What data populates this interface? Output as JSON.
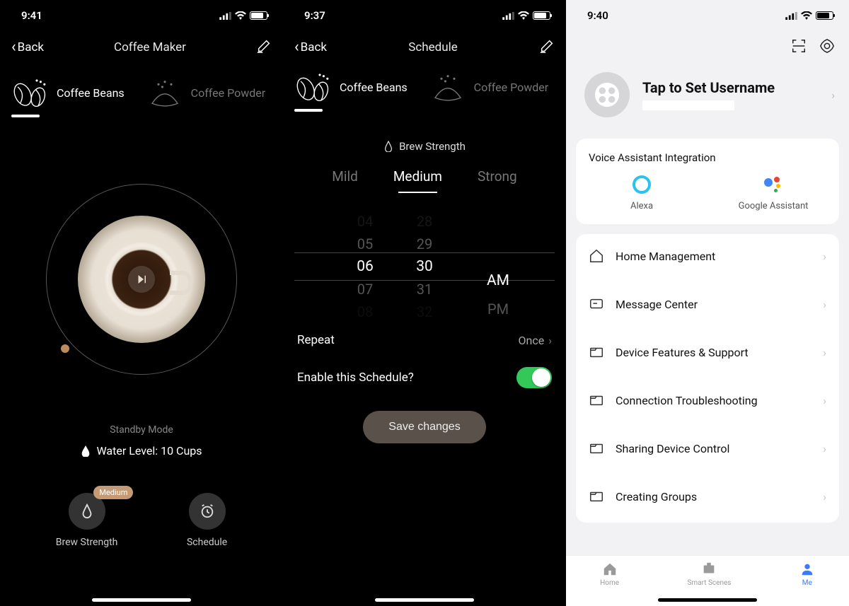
{
  "phone1": {
    "time": "9:41",
    "back": "Back",
    "title": "Coffee Maker",
    "tabs": {
      "beans": "Coffee Beans",
      "powder": "Coffee Powder"
    },
    "standby": "Standby Mode",
    "water_label": "Water Level:  10 Cups",
    "brew_badge": "Medium",
    "brew_label": "Brew Strength",
    "schedule_label": "Schedule"
  },
  "phone2": {
    "time": "9:37",
    "back": "Back",
    "title": "Schedule",
    "tabs": {
      "beans": "Coffee Beans",
      "powder": "Coffee Powder"
    },
    "brew_section": "Brew Strength",
    "strengths": {
      "mild": "Mild",
      "medium": "Medium",
      "strong": "Strong"
    },
    "picker": {
      "hours": [
        "04",
        "05",
        "06",
        "07",
        "08"
      ],
      "minutes": [
        "28",
        "29",
        "30",
        "31",
        "32"
      ],
      "ampm": [
        "AM",
        "PM"
      ],
      "selected": {
        "hour": "06",
        "minute": "30",
        "ampm": "AM"
      }
    },
    "repeat_label": "Repeat",
    "repeat_value": "Once",
    "enable_label": "Enable this Schedule?",
    "enable_value": true,
    "save": "Save changes"
  },
  "phone3": {
    "time": "9:40",
    "profile": "Tap to Set Username",
    "voice_title": "Voice Assistant Integration",
    "alexa": "Alexa",
    "ga": "Google Assistant",
    "items": {
      "home": "Home Management",
      "msg": "Message Center",
      "support": "Device Features & Support",
      "conn": "Connection Troubleshooting",
      "share": "Sharing Device Control",
      "groups": "Creating Groups"
    },
    "tabs": {
      "home": "Home",
      "scenes": "Smart Scenes",
      "me": "Me"
    }
  }
}
